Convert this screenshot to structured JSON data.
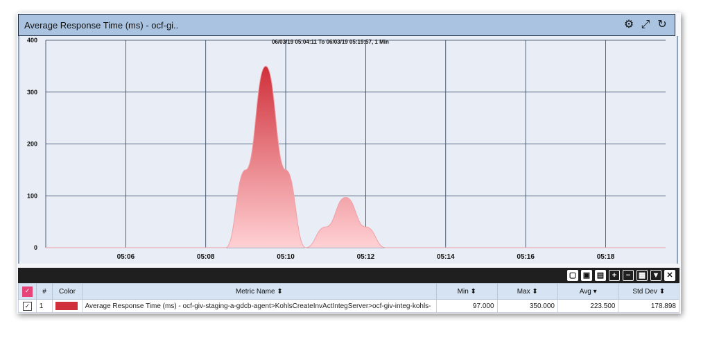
{
  "title": "Average Response Time (ms) - ocf-gi..",
  "toolbar_icons": [
    "gear-icon",
    "collapse-icon",
    "refresh-icon"
  ],
  "range_label": "06/03/19 05:04:11 To 06/03/19 05:19:57, 1 Min",
  "table_buttons": [
    "pdf-icon",
    "excel-icon",
    "export-icon",
    "plus-icon",
    "minus-icon",
    "grid-icon",
    "filter-icon",
    "close-icon"
  ],
  "table": {
    "headers": {
      "num": "#",
      "color": "Color",
      "metric": "Metric Name ⬍",
      "min": "Min ⬍",
      "max": "Max ⬍",
      "avg": "Avg ▾",
      "std": "Std Dev ⬍"
    },
    "row": {
      "num": "1",
      "color": "#d0303a",
      "metric": "Average Response Time (ms) - ocf-giv-staging-a-gdcb-agent>KohlsCreateInvActIntegServer>ocf-giv-integ-kohls-",
      "min": "97.000",
      "max": "350.000",
      "avg": "223.500",
      "std": "178.898"
    }
  },
  "chart_data": {
    "type": "area",
    "ylim": [
      0,
      400
    ],
    "yticks": [
      0,
      100,
      200,
      300,
      400
    ],
    "xticks": [
      "05:06",
      "05:08",
      "05:10",
      "05:12",
      "05:14",
      "05:16",
      "05:18"
    ],
    "series": [
      {
        "color": "#d0303a",
        "points": [
          [
            "05:04",
            0
          ],
          [
            "05:08",
            0
          ],
          [
            "05:08.5",
            0
          ],
          [
            "05:09",
            150
          ],
          [
            "05:09.5",
            350
          ],
          [
            "05:10",
            150
          ],
          [
            "05:10.5",
            0
          ],
          [
            "05:11",
            40
          ],
          [
            "05:11.5",
            97
          ],
          [
            "05:12",
            40
          ],
          [
            "05:12.5",
            0
          ],
          [
            "05:19.5",
            0
          ]
        ]
      }
    ]
  }
}
